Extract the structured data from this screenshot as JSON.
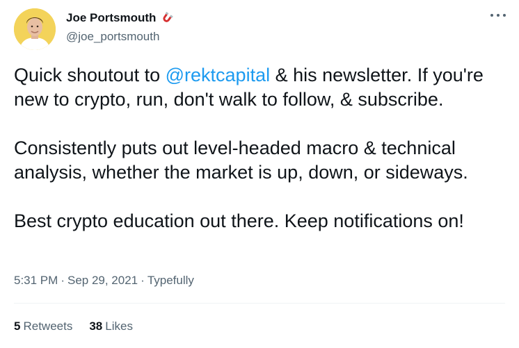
{
  "author": {
    "name": "Joe Portsmouth",
    "handle": "@joe_portsmouth",
    "avatar_bg": "#f3d35a"
  },
  "tweet": {
    "line1_pre": "Quick shoutout to ",
    "mention": "@rektcapital",
    "line1_post": " & his newsletter. If you're new to crypto, run, don't walk to follow, & subscribe.",
    "para2": "Consistently puts out level-headed macro & technical analysis, whether the market is up, down, or sideways.",
    "para3": "Best crypto education out there. Keep notifications on!"
  },
  "meta": {
    "time": "5:31 PM",
    "date": "Sep 29, 2021",
    "source": "Typefully",
    "separator": "·"
  },
  "stats": {
    "retweets_count": "5",
    "retweets_label": "Retweets",
    "likes_count": "38",
    "likes_label": "Likes"
  },
  "colors": {
    "link": "#1d9bf0",
    "secondary": "#536471",
    "text": "#0f1419"
  }
}
